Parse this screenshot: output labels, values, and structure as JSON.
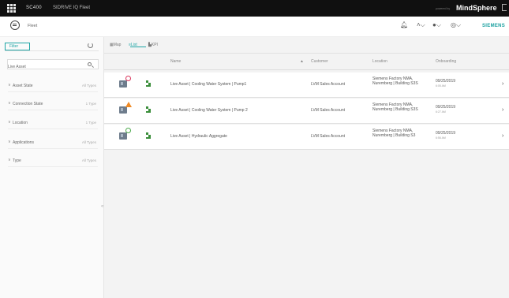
{
  "header": {
    "app_code": "SC400",
    "app_name": "SIDRIVE IQ Fleet",
    "powered_by": "powered by",
    "brand": "MindSphere"
  },
  "subheader": {
    "fleet_label": "Fleet",
    "icons": [
      "bell-icon",
      "user-icon",
      "help-icon",
      "globe-icon"
    ],
    "company": "SIEMENS",
    "accent": "#1aa0a0"
  },
  "sidebar": {
    "filter_tab": "Filter",
    "search_value": "Live Asset",
    "groups": [
      {
        "label": "Asset State",
        "value": "All Types"
      },
      {
        "label": "Connection State",
        "value": "1 Type"
      },
      {
        "label": "Location",
        "value": "1 Type"
      },
      {
        "label": "Applications",
        "value": "All Types"
      },
      {
        "label": "Type",
        "value": "All Types"
      }
    ]
  },
  "view_tabs": [
    "Map",
    "List",
    "KPI"
  ],
  "columns": {
    "name": "Name",
    "customer": "Customer",
    "location": "Location",
    "onboarding": "Onboarding"
  },
  "rows": [
    {
      "status": "error",
      "name": "Live Asset | Cooling Water System | Pump1",
      "customer": "LVM Sales Account",
      "location": "Siemens Factory NMA, Nuremberg | Building S3S",
      "date": "09/25/2019",
      "time": "6:05 AM"
    },
    {
      "status": "warning",
      "name": "Live Asset | Cooling Water System | Pump 2",
      "customer": "LVM Sales Account",
      "location": "Siemens Factory NMA, Nuremberg | Building S3S",
      "date": "09/25/2019",
      "time": "6:27 AM"
    },
    {
      "status": "ok",
      "name": "Live Asset | Hydraulic Aggregate",
      "customer": "LVM Sales Account",
      "location": "Siemens Factory NMA, Nuremberg | Building S3",
      "date": "09/25/2019",
      "time": "6:56 AM"
    }
  ],
  "status_colors": {
    "error": "#d9345a",
    "warning": "#f08a24",
    "ok": "#4aa84a"
  }
}
